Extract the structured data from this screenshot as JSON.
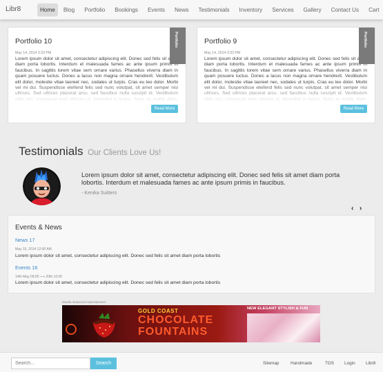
{
  "nav": {
    "brand": "Libr8",
    "items": [
      {
        "label": "Home",
        "active": true
      },
      {
        "label": "Blog"
      },
      {
        "label": "Portfolio"
      },
      {
        "label": "Bookings"
      },
      {
        "label": "Events"
      },
      {
        "label": "News"
      },
      {
        "label": "Testimonials"
      },
      {
        "label": "Inventory"
      },
      {
        "label": "Services"
      },
      {
        "label": "Gallery"
      },
      {
        "label": "Contact Us"
      },
      {
        "label": "Cart"
      }
    ]
  },
  "portfolio": [
    {
      "title": "Portfolio 10",
      "ribbon": "Portfolio",
      "date": "May 14, 2014 3:33 PM",
      "body": "Lorem ipsum dolor sit amet, consectetur adipiscing elit. Donec sed felis sit amet diam porta lobortis. Interdum et malesuada fames ac ante ipsum primis in faucibus. In sagittis lorem vitae sem ornare varius. Phasellus viverra diam in quam posuere luctus. Donec a lacus non magna ornare hendrerit. Vestibulum elit dolor, molestie vitae laoreet nec, sodales ut turpis. Cras eu leo dolor. Morbi vel mi dui. Suspendisse eleifend felis sed nunc volutpat, sit amet semper nisi ultrices. Sed ultrices placerat arcu, sed faucibus nulla suscipit id. Vestibulum nibh orci, consequat eget ultricies ut, imperdiet in lectus. Nunc ac mattis diam, ac eleifend",
      "more": "Read More"
    },
    {
      "title": "Portfolio 9",
      "ribbon": "Portfolio",
      "date": "May 14, 2014 3:33 PM",
      "body": "Lorem ipsum dolor sit amet, consectetur adipiscing elit. Donec sed felis sit amet diam porta lobortis. Interdum et malesuada fames ac ante ipsum primis in faucibus. In sagittis lorem vitae sem ornare varius. Phasellus viverra diam in quam posuere luctus. Donec a lacus non magna ornare hendrerit. Vestibulum elit dolor, molestie vitae laoreet nec, sodales ut turpis. Cras eu leo dolor. Morbi vel mi dui. Suspendisse eleifend felis sed nunc volutpat, sit amet semper nisi ultrices. Sed ultrices placerat arcu, sed faucibus nulla suscipit id. Vestibulum nibh orci, consequat eget ultricies ut, imperdiet in lectus. Nunc ac mattis diam, ac eleifend",
      "more": "Read More"
    }
  ],
  "testimonials": {
    "heading": "Testimonials",
    "subheading": "Our Clients Love Us!",
    "quote": "Lorem ipsum dolor sit amet, consectetur adipiscing elit. Donec sed felis sit amet diam porta lobortis. Interdum et malesuada fames ac ante ipsum primis in faucibus.",
    "author": "- Kenika Suitters",
    "prev": "‹",
    "next": "›"
  },
  "events": {
    "heading": "Events & News",
    "items": [
      {
        "title": "News 17",
        "meta": "May 15, 2014 12:00 AM",
        "text": "Lorem ipsum dolor sit amet, consectetur adipiscing elit. Donec sed felis sit amet diam porta lobortis"
      },
      {
        "title": "Events 16",
        "meta": "14th May 09:00 ⟶ 20th 10:00",
        "text": "Lorem ipsum dolor sit amet, consectetur adipiscing elit. Donec sed felis sit amet diam porta lobortis"
      }
    ]
  },
  "ad": {
    "label": "Studio Seduced Advertisment",
    "line1": "GOLD COAST",
    "line2": "CHOCOLATE",
    "line3": "FOUNTAINS",
    "tagline": "NEW ELEGANT STYLISH & FUN"
  },
  "footer": {
    "search_placeholder": "Search...",
    "search_button": "Search",
    "links": [
      "Sitemap",
      "Handmade",
      "TOS",
      "Login",
      "Libr8"
    ]
  }
}
